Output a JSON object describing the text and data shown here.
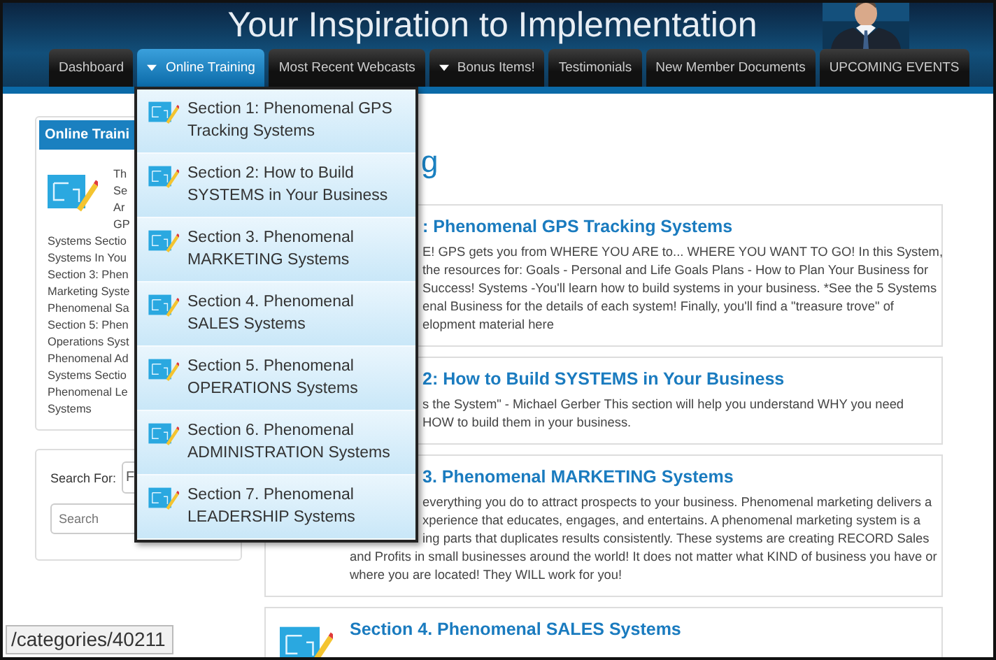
{
  "header": {
    "title": "Your Inspiration to Implementation"
  },
  "nav": [
    {
      "label": "Dashboard",
      "selected": false,
      "has_menu": false
    },
    {
      "label": "Online Training",
      "selected": true,
      "has_menu": true
    },
    {
      "label": "Most Recent Webcasts",
      "selected": false,
      "has_menu": false
    },
    {
      "label": "Bonus Items!",
      "selected": false,
      "has_menu": true
    },
    {
      "label": "Testimonials",
      "selected": false,
      "has_menu": false
    },
    {
      "label": "New Member Documents",
      "selected": false,
      "has_menu": false
    },
    {
      "label": "UPCOMING EVENTS",
      "selected": false,
      "has_menu": false
    }
  ],
  "dropdown_menu": [
    "Section 1: Phenomenal GPS Tracking Systems",
    "Section 2: How to Build SYSTEMS in Your Business",
    "Section 3. Phenomenal MARKETING Systems",
    "Section 4. Phenomenal SALES Systems",
    "Section 5. Phenomenal OPERATIONS Systems",
    "Section 6. Phenomenal ADMINISTRATION Systems",
    "Section 7. Phenomenal LEADERSHIP Systems"
  ],
  "sidebar": {
    "training_panel": {
      "title": "Online Traini",
      "beside_icon": [
        "Th",
        "Se",
        "Ar",
        "GP"
      ],
      "lines": [
        "Systems Sectio",
        "Systems In You",
        "Section 3: Phen",
        "Marketing Syste",
        "Phenomenal Sa",
        "Section 5: Phen",
        "Operations Syst",
        "Phenomenal Ad",
        "Systems Sectio",
        "Phenomenal Le",
        "Systems"
      ]
    },
    "search_panel": {
      "label": "Search For:",
      "select_value": "F",
      "search_placeholder": "Search"
    }
  },
  "main": {
    "heading": "g",
    "cards": [
      {
        "kind": "cut",
        "title": ": Phenomenal GPS Tracking Systems",
        "lines": [
          {
            "kind": "cut",
            "text": "E! GPS gets you from WHERE YOU ARE to... WHERE YOU WANT TO GO! In this System,"
          },
          {
            "kind": "cut",
            "text": "the resources for: Goals - Personal and Life Goals Plans - How to Plan Your Business for"
          },
          {
            "kind": "cut",
            "text": "Success! Systems -You'll learn how to build systems in your business. *See the 5 Systems"
          },
          {
            "kind": "cut",
            "text": "enal Business for the details of each system! Finally, you'll find a \"treasure trove\" of"
          },
          {
            "kind": "cut",
            "text": "elopment material here"
          }
        ]
      },
      {
        "kind": "cut",
        "title": "2: How to Build SYSTEMS in Your Business",
        "lines": [
          {
            "kind": "cut",
            "text": "s the System\" - Michael Gerber This section will help you understand WHY you need"
          },
          {
            "kind": "cut",
            "text": "HOW to build them in your business."
          }
        ]
      },
      {
        "kind": "cut",
        "title": "3. Phenomenal MARKETING Systems",
        "lines": [
          {
            "kind": "cut",
            "text": "everything you do to attract prospects to your business. Phenomenal marketing delivers a"
          },
          {
            "kind": "cut",
            "text": "xperience that educates, engages, and entertains. A phenomenal marketing system is a"
          },
          {
            "kind": "cut",
            "text": "ing parts that duplicates results consistently. These systems are creating RECORD Sales"
          },
          {
            "kind": "full",
            "text": "and Profits in small businesses around the world! It does not matter what KIND of business you have or"
          },
          {
            "kind": "full",
            "text": "where you are located! They WILL work for you!"
          }
        ]
      },
      {
        "kind": "full",
        "title": "Section 4. Phenomenal SALES Systems"
      }
    ]
  },
  "status_bar": {
    "url": "/categories/40211"
  }
}
